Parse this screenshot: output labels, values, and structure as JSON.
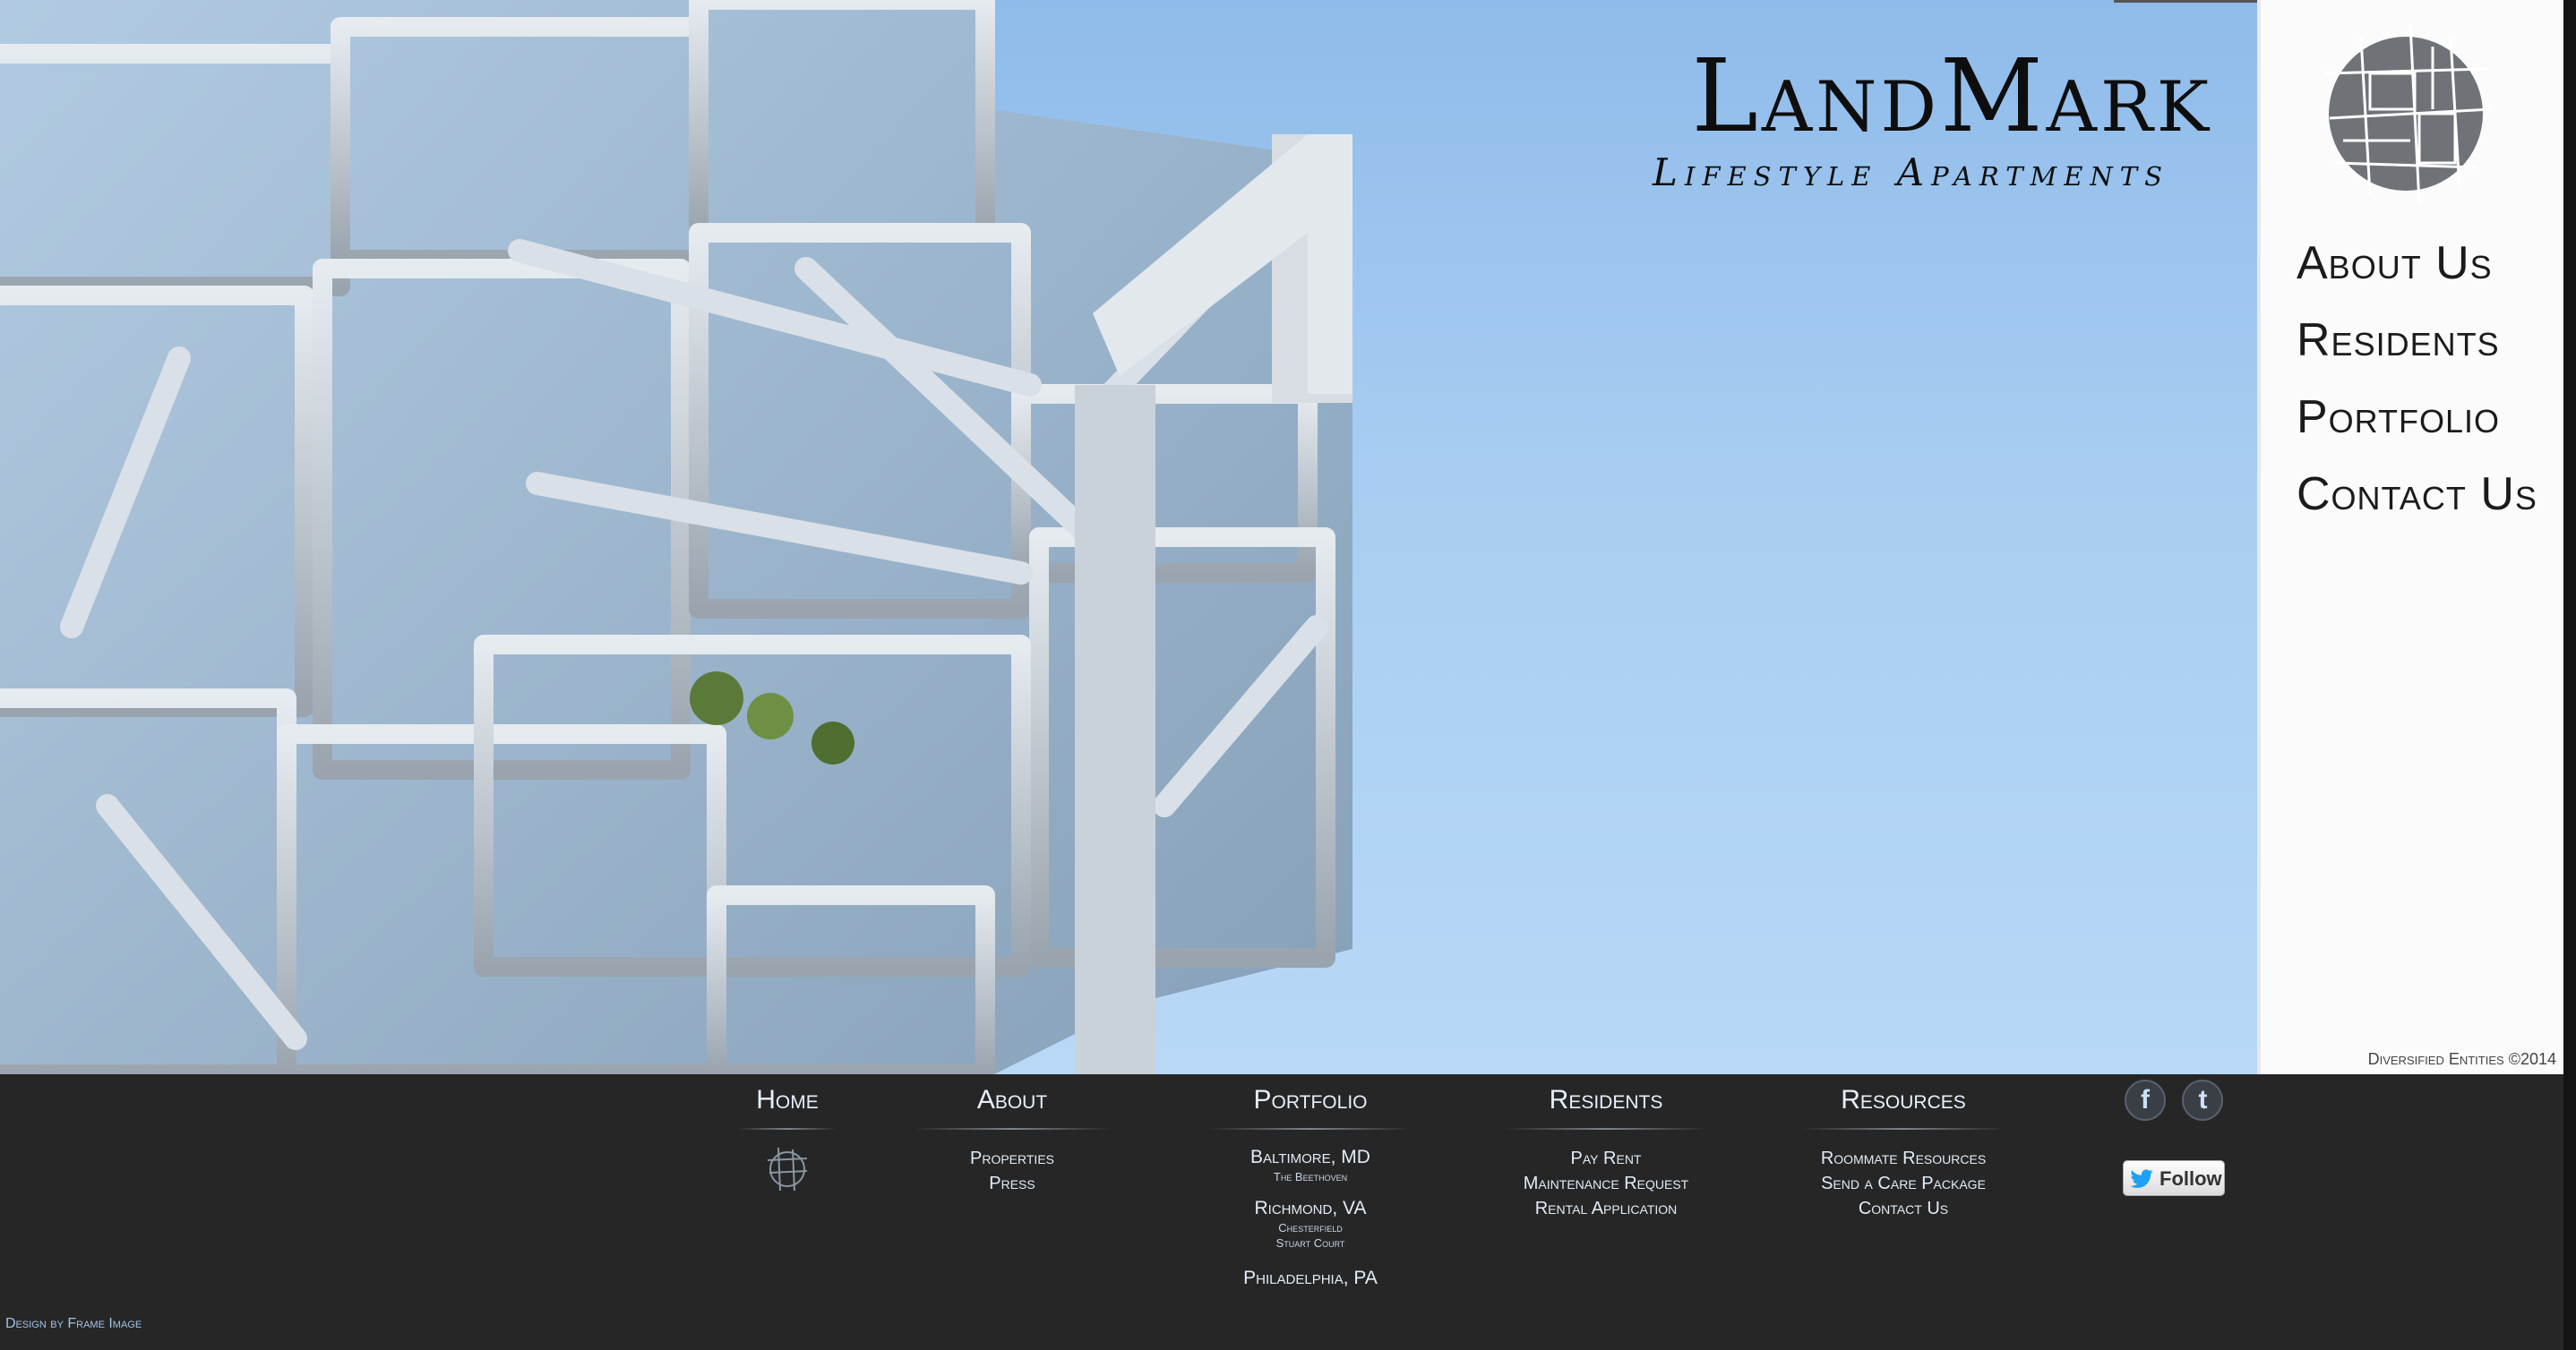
{
  "brand": {
    "name": "LandMark",
    "tagline": "Lifestyle Apartments"
  },
  "nav": [
    {
      "label": "About Us"
    },
    {
      "label": "Residents"
    },
    {
      "label": "Portfolio"
    },
    {
      "label": "Contact Us"
    }
  ],
  "copyright": "Diversified Entities ©2014",
  "footer": {
    "home": {
      "label": "Home"
    },
    "about": {
      "label": "About",
      "items": [
        "Properties",
        "Press"
      ]
    },
    "portfolio": {
      "label": "Portfolio",
      "cities": [
        {
          "city": "Baltimore, MD",
          "subs": [
            "The Beethoven"
          ]
        },
        {
          "city": "Richmond, VA",
          "subs": [
            "Chesterfield",
            "Stuart Court"
          ]
        },
        {
          "city": "Philadelphia, PA",
          "subs": []
        }
      ]
    },
    "residents": {
      "label": "Residents",
      "items": [
        "Pay Rent",
        "Maintenance Request",
        "Rental Application"
      ]
    },
    "resources": {
      "label": "Resources",
      "items": [
        "Roommate Resources",
        "Send a Care Package",
        "Contact Us"
      ]
    }
  },
  "social": {
    "facebook_glyph": "f",
    "twitter_glyph": "t",
    "follow_label": "Follow"
  },
  "credit": "Design by Frame Image",
  "colors": {
    "sky": "#a9cdf2",
    "footer_bg": "#262626",
    "footer_text": "#e2ecf8",
    "sidebar_bg": "#fbfbfb"
  },
  "icons": [
    "building-photo",
    "landmark-emblem-icon",
    "facebook-icon",
    "twitter-icon",
    "twitter-bird-icon"
  ]
}
